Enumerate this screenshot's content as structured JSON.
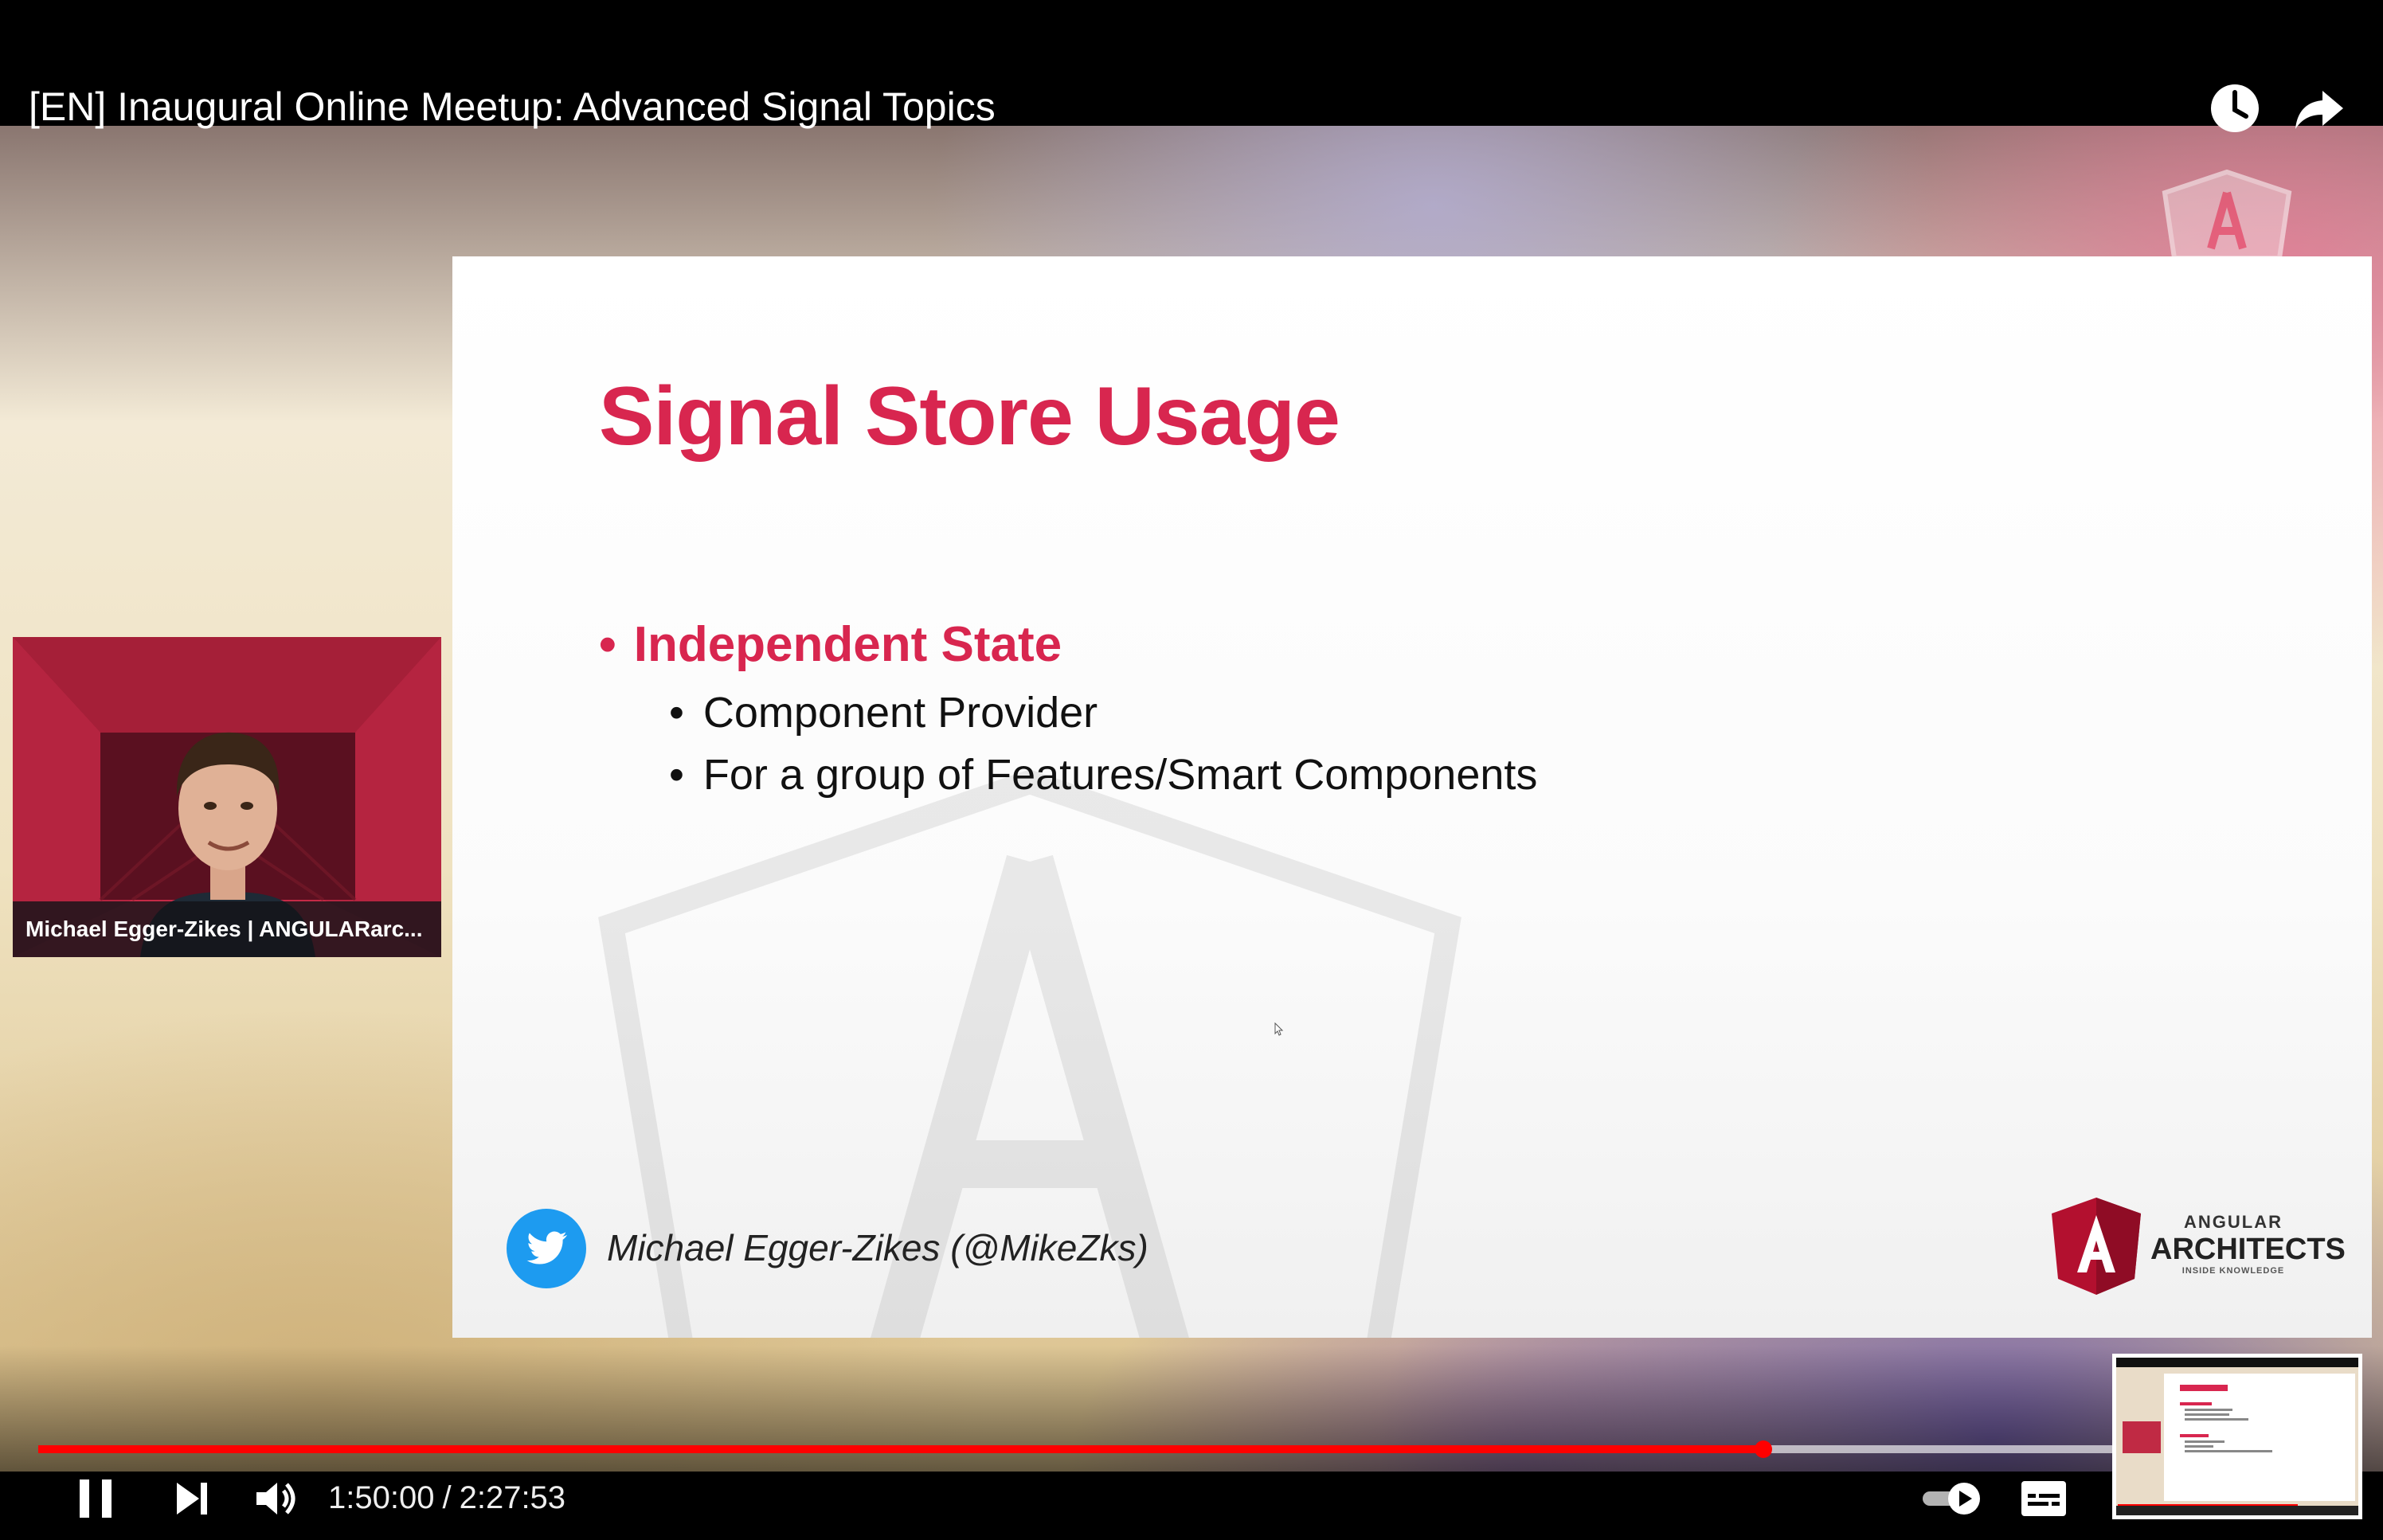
{
  "video": {
    "title": "[EN] Inaugural Online Meetup: Advanced Signal Topics",
    "top_actions": [
      {
        "name": "watch-later",
        "icon": "clock-icon"
      },
      {
        "name": "share",
        "icon": "share-arrow-icon"
      }
    ]
  },
  "slide": {
    "title": "Signal Store Usage",
    "bullet": "Independent State",
    "sub_bullets": [
      "Component Provider",
      "For a group of Features/Smart Components"
    ],
    "bullet_symbol": "•",
    "footer_handle": "Michael Egger-Zikes (@MikeZks)",
    "logo": {
      "small": "ANGULAR",
      "big": "ARCHITECTS",
      "tiny": "INSIDE KNOWLEDGE"
    },
    "accent_color": "#d8264f"
  },
  "webcam": {
    "name": "Michael Egger-Zikes | ANGULARarc..."
  },
  "player": {
    "current_time": "1:50:00",
    "separator": "/",
    "duration": "2:27:53",
    "progress_played": 0.748,
    "progress_loaded": 0.9,
    "progress_color": "#ff0000",
    "autoplay_on": true
  }
}
